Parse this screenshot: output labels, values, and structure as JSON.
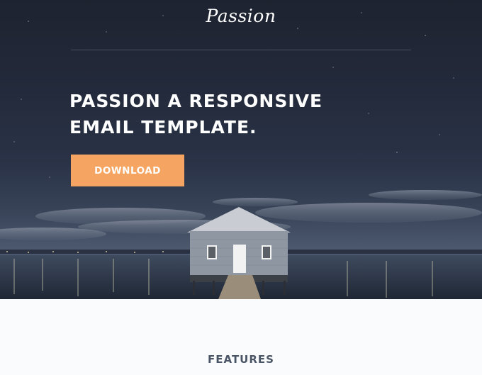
{
  "brand": {
    "logo_text": "Passion"
  },
  "hero": {
    "headline": "PASSION  A RESPONSIVE\nEMAIL TEMPLATE.",
    "cta_label": "DOWNLOAD",
    "cta_color": "#f5a461"
  },
  "features": {
    "title": "FEATURES"
  },
  "colors": {
    "hero_sky": "#232a3b",
    "page_bg": "#fafbfc",
    "section_heading": "#4a5566"
  }
}
